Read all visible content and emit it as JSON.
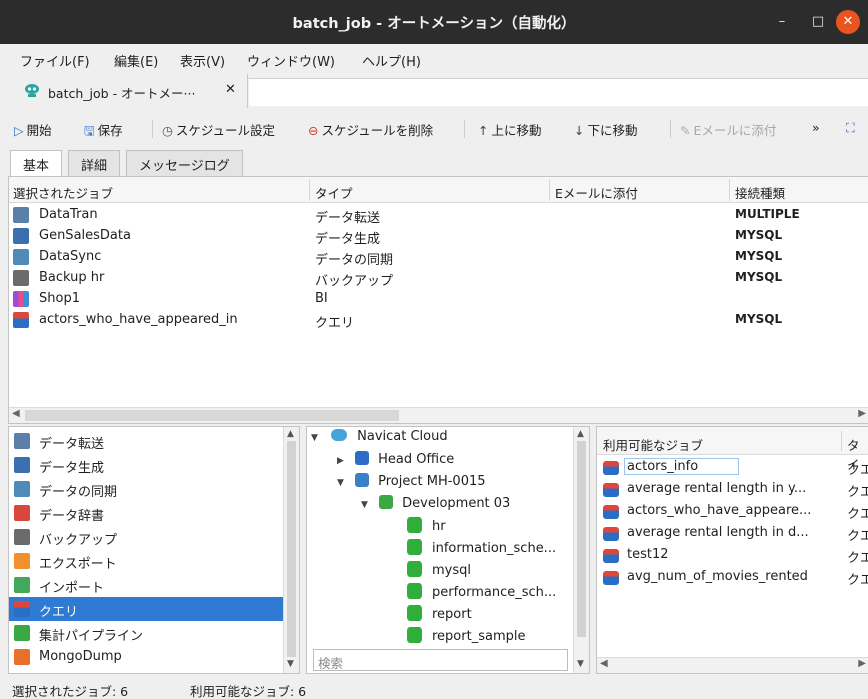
{
  "window": {
    "title": "batch_job - オートメーション（自動化）",
    "min_glyph": "–",
    "max_glyph": "□",
    "close_glyph": "✕"
  },
  "menu": [
    "ファイル(F)",
    "編集(E)",
    "表示(V)",
    "ウィンドウ(W)",
    "ヘルプ(H)"
  ],
  "doc_tab": {
    "label": "batch_job - オートメー···",
    "close": "✕"
  },
  "toolbar": {
    "start": "開始",
    "save": "保存",
    "schedule_settings": "スケジュール設定",
    "delete_schedule": "スケジュールを削除",
    "move_up": "上に移動",
    "move_down": "下に移動",
    "attach_email": "Eメールに添付",
    "more": "»"
  },
  "tabs": [
    "基本",
    "詳細",
    "メッセージログ"
  ],
  "selected_jobs": {
    "headers": [
      "選択されたジョブ",
      "タイプ",
      "Eメールに添付",
      "接続種類"
    ],
    "rows": [
      {
        "name": "DataTran",
        "type": "データ転送",
        "email": "",
        "conn": "MULTIPLE",
        "icon": "data-transfer-icon"
      },
      {
        "name": "GenSalesData",
        "type": "データ生成",
        "email": "",
        "conn": "MYSQL",
        "icon": "data-generation-icon"
      },
      {
        "name": "DataSync",
        "type": "データの同期",
        "email": "",
        "conn": "MYSQL",
        "icon": "data-sync-icon"
      },
      {
        "name": "Backup hr",
        "type": "バックアップ",
        "email": "",
        "conn": "MYSQL",
        "icon": "backup-icon"
      },
      {
        "name": "Shop1",
        "type": "BI",
        "email": "",
        "conn": "",
        "icon": "bi-icon"
      },
      {
        "name": "actors_who_have_appeared_in",
        "type": "クエリ",
        "email": "",
        "conn": "MYSQL",
        "icon": "query-icon"
      }
    ]
  },
  "job_types": [
    {
      "label": "データ転送",
      "icon": "data-transfer-icon"
    },
    {
      "label": "データ生成",
      "icon": "data-generation-icon"
    },
    {
      "label": "データの同期",
      "icon": "data-sync-icon"
    },
    {
      "label": "データ辞書",
      "icon": "data-dictionary-icon"
    },
    {
      "label": "バックアップ",
      "icon": "backup-icon"
    },
    {
      "label": "エクスポート",
      "icon": "export-icon"
    },
    {
      "label": "インポート",
      "icon": "import-icon"
    },
    {
      "label": "クエリ",
      "icon": "query-icon",
      "selected": true
    },
    {
      "label": "集計パイプライン",
      "icon": "aggregation-pipeline-icon"
    },
    {
      "label": "MongoDump",
      "icon": "mongodump-icon"
    }
  ],
  "connection_tree": {
    "root": "Navicat Cloud",
    "head_office": "Head Office",
    "project": "Project MH-0015",
    "connection": "Development 03",
    "databases": [
      "hr",
      "information_sche...",
      "mysql",
      "performance_sch...",
      "report",
      "report_sample"
    ]
  },
  "search": {
    "placeholder": "検索"
  },
  "available_jobs": {
    "headers": [
      "利用可能なジョブ",
      "タイ"
    ],
    "rows": [
      {
        "name": "actors_info",
        "type": "クエ"
      },
      {
        "name": "average rental length in y...",
        "type": "クエ"
      },
      {
        "name": "actors_who_have_appeare...",
        "type": "クエ"
      },
      {
        "name": "average rental length in d...",
        "type": "クエ"
      },
      {
        "name": "test12",
        "type": "クエ"
      },
      {
        "name": "avg_num_of_movies_rented",
        "type": "クエ"
      }
    ]
  },
  "status": {
    "selected": "選択されたジョブ: 6",
    "available": "利用可能なジョブ: 6"
  },
  "colors": {
    "titlebar": "#2c2c2c",
    "close_button": "#e95420",
    "selection": "#2f7bd4",
    "db_green": "#2fae3a"
  }
}
